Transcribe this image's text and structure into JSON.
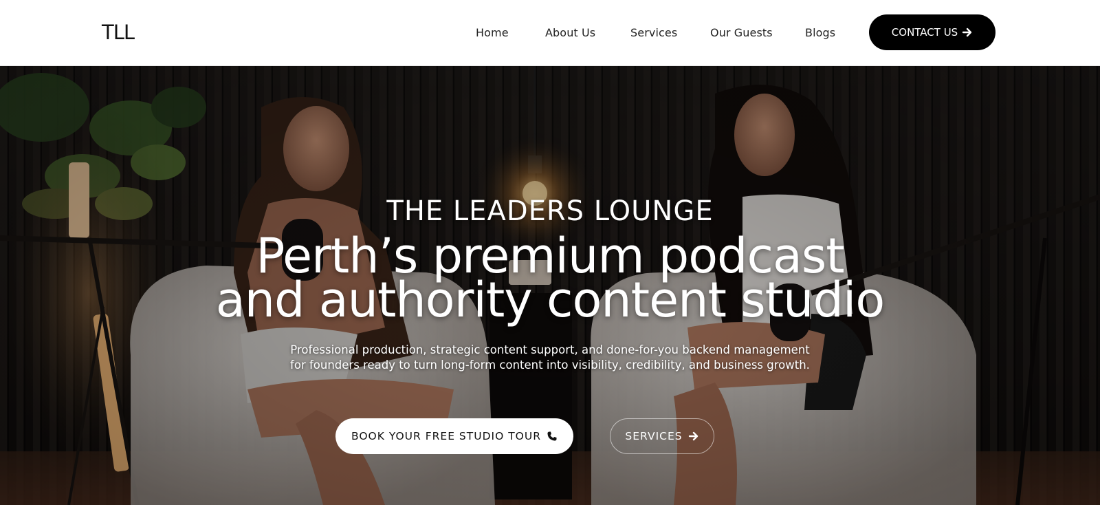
{
  "header": {
    "logo": "TLL",
    "nav": [
      {
        "label": "Home"
      },
      {
        "label": "About Us"
      },
      {
        "label": "Services"
      },
      {
        "label": "Our Guests"
      },
      {
        "label": "Blogs"
      }
    ],
    "contact_label": "CONTACT US"
  },
  "hero": {
    "eyebrow": "THE LEADERS LOUNGE",
    "headline_line1": "Perth’s premium podcast",
    "headline_line2": "and authority content studio",
    "subtitle": "Professional production, strategic content support, and done-for-you backend management for founders ready to turn long-form content into visibility, credibility, and business growth.",
    "primary_cta": "BOOK YOUR FREE STUDIO TOUR",
    "secondary_cta": "SERVICES"
  },
  "icons": {
    "contact": "arrow-right-icon",
    "tour": "phone-icon",
    "services": "arrow-right-icon"
  },
  "colors": {
    "header_bg": "#ffffff",
    "button_dark": "#000000",
    "button_light": "#ffffff",
    "hero_text": "#ffffff"
  }
}
